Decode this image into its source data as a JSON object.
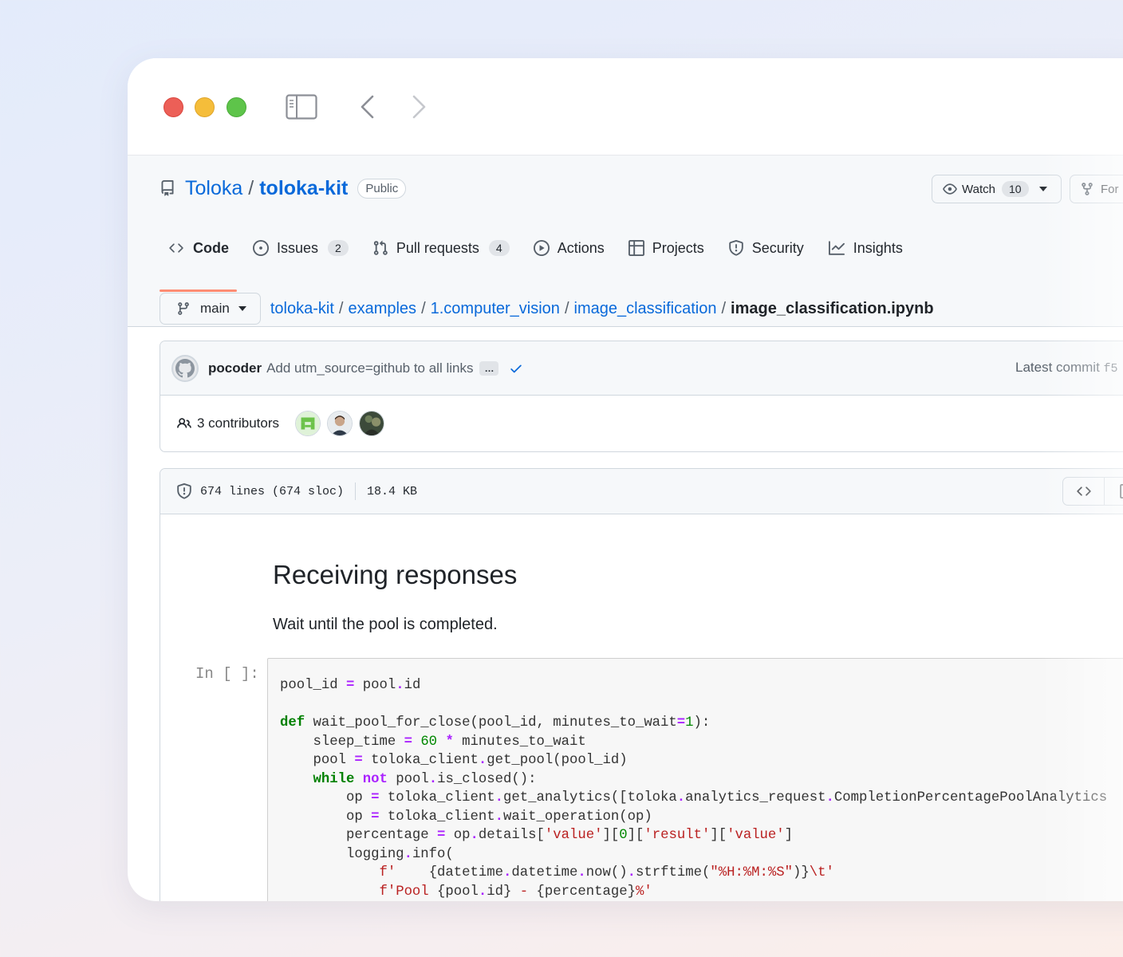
{
  "repo": {
    "owner": "Toloka",
    "separator": "/",
    "name": "toloka-kit",
    "visibility": "Public",
    "watch_label": "Watch",
    "watch_count": "10",
    "fork_label": "For"
  },
  "tabs": [
    {
      "label": "Code",
      "icon": "code-icon"
    },
    {
      "label": "Issues",
      "count": "2",
      "icon": "issue-icon"
    },
    {
      "label": "Pull requests",
      "count": "4",
      "icon": "pull-request-icon"
    },
    {
      "label": "Actions",
      "icon": "play-icon"
    },
    {
      "label": "Projects",
      "icon": "table-icon"
    },
    {
      "label": "Security",
      "icon": "shield-icon"
    },
    {
      "label": "Insights",
      "icon": "graph-icon"
    }
  ],
  "branch": "main",
  "breadcrumb": {
    "parts": [
      "toloka-kit",
      "examples",
      "1.computer_vision",
      "image_classification"
    ],
    "current": "image_classification.ipynb",
    "separator": "/"
  },
  "commit": {
    "author": "pocoder",
    "message": "Add utm_source=github to all links",
    "ellipsis": "…",
    "latest_label": "Latest commit",
    "hash": "f5"
  },
  "contributors": {
    "label": "3 contributors"
  },
  "file_info": {
    "lines": "674 lines (674 sloc)",
    "size": "18.4 KB"
  },
  "notebook": {
    "heading": "Receiving responses",
    "text": "Wait until the pool is completed.",
    "prompt": "In [ ]:"
  },
  "colors": {
    "link": "#0969da",
    "tab_underline": "#fd8c73",
    "keyword": "#008000",
    "operator": "#aa22ff",
    "string": "#ba2121"
  }
}
